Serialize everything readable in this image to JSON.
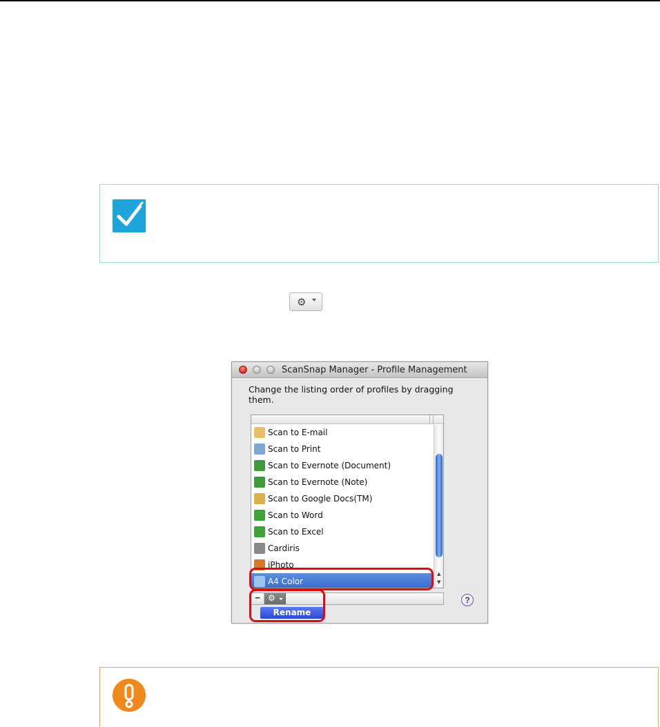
{
  "window": {
    "title": "ScanSnap Manager - Profile Management",
    "instruction": "Change the listing order of profiles by dragging them."
  },
  "profiles": [
    {
      "label": "Scan to E-mail",
      "icon": "email-icon",
      "color": "#e8c06a"
    },
    {
      "label": "Scan to Print",
      "icon": "printer-icon",
      "color": "#7fa7d6"
    },
    {
      "label": "Scan to Evernote (Document)",
      "icon": "evernote-document-icon",
      "color": "#3e9a3a"
    },
    {
      "label": "Scan to Evernote (Note)",
      "icon": "evernote-note-icon",
      "color": "#3e9a3a"
    },
    {
      "label": "Scan to Google Docs(TM)",
      "icon": "google-docs-icon",
      "color": "#d9b24a"
    },
    {
      "label": "Scan to Word",
      "icon": "word-icon",
      "color": "#3fa33a"
    },
    {
      "label": "Scan to Excel",
      "icon": "excel-icon",
      "color": "#3fa33a"
    },
    {
      "label": "Cardiris",
      "icon": "cardiris-icon",
      "color": "#8a8a8a"
    },
    {
      "label": "iPhoto",
      "icon": "iphoto-icon",
      "color": "#d27a2a"
    },
    {
      "label": "A4 Color",
      "icon": "folder-icon",
      "color": "#9cc3ea",
      "selected": true
    }
  ],
  "toolbar": {
    "remove_label": "−",
    "action_menu_icon": "gear-icon",
    "rename_label": "Rename",
    "help_label": "?"
  },
  "colors": {
    "hint_border": "#8fe3d5",
    "hint_icon": "#1ea5dc",
    "caution_border": "#f0a53a",
    "caution_icon": "#ee8a1c",
    "highlight": "#e00812",
    "selection": "#3468cc"
  }
}
